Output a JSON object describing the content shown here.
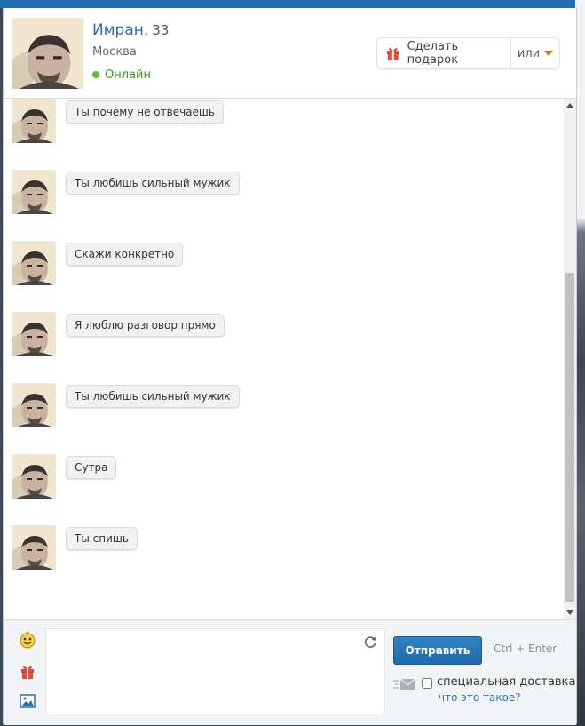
{
  "header": {
    "name": "Имран,",
    "age": "33",
    "city": "Москва",
    "status": "Онлайн",
    "gift_button": "Сделать подарок",
    "or_button": "или"
  },
  "messages": [
    {
      "text": "Ты почему не отвечаешь"
    },
    {
      "text": "Ты любишь сильный мужик"
    },
    {
      "text": "Скажи конкретно"
    },
    {
      "text": "Я люблю разговор прямо"
    },
    {
      "text": "Ты любишь сильный мужик"
    },
    {
      "text": "Сутра"
    },
    {
      "text": "Ты спишь"
    }
  ],
  "composer": {
    "message_value": "",
    "send_button": "Отправить",
    "hotkey_hint": "Ctrl + Enter",
    "special_delivery_label": "специальная доставка",
    "special_delivery_checked": false,
    "whats_this_link": "что это такое?"
  },
  "icons": {
    "emoji": "smiley-icon",
    "gift": "gift-icon",
    "photo": "image-icon",
    "refresh": "refresh-icon",
    "envelope": "envelope-icon",
    "caret": "caret-down-icon"
  },
  "colors": {
    "accent": "#2a6fae",
    "online": "#3c9a1f",
    "send_button": "#2576b9",
    "caret": "#e46b21",
    "link": "#2a74b8"
  }
}
